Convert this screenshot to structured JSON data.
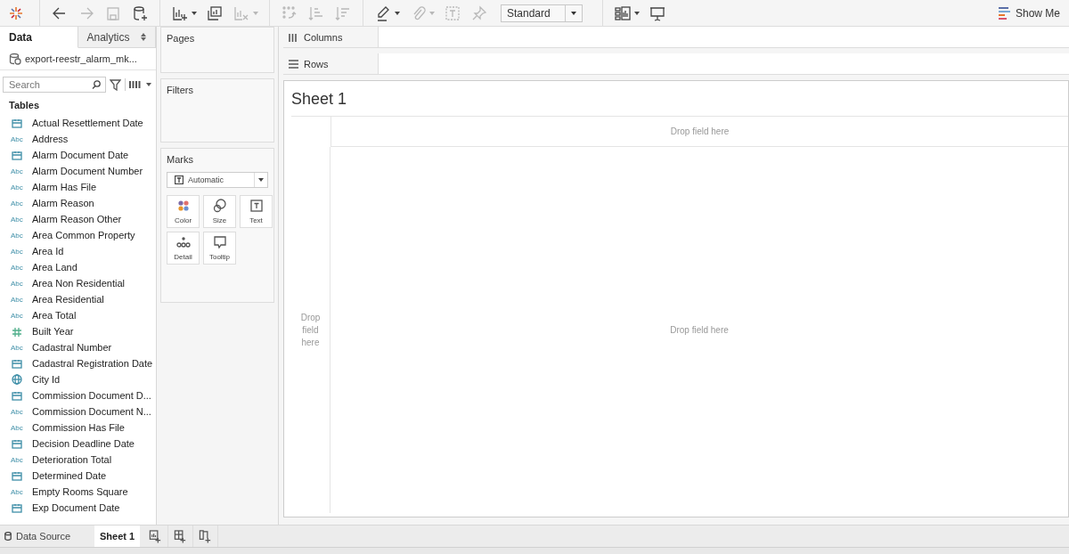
{
  "toolbar": {
    "buttons": [
      {
        "disabled": false,
        "caret": false
      },
      {
        "disabled": true,
        "caret": false
      },
      {
        "disabled": true,
        "caret": false
      },
      {
        "disabled": false,
        "caret": false
      },
      {
        "disabled": false,
        "caret": true
      },
      {
        "disabled": false,
        "caret": false
      },
      {
        "disabled": true,
        "caret": true
      },
      {
        "disabled": true,
        "caret": false
      },
      {
        "disabled": true,
        "caret": false
      },
      {
        "disabled": true,
        "caret": false
      },
      {
        "disabled": false,
        "caret": true
      },
      {
        "disabled": true,
        "caret": true
      },
      {
        "disabled": true,
        "caret": false
      },
      {
        "disabled": true,
        "caret": false
      }
    ],
    "view_select": "Standard",
    "end_buttons": [
      {
        "caret": true
      },
      {
        "caret": false
      }
    ],
    "show_me": "Show Me"
  },
  "data_pane": {
    "tabs": [
      {
        "label": "Data",
        "selected": true
      },
      {
        "label": "Analytics",
        "selected": false
      }
    ],
    "datasource": "export-reestr_alarm_mk...",
    "search": {
      "placeholder": "Search"
    },
    "tables_heading": "Tables",
    "fields": [
      {
        "name": "Actual Resettlement Date",
        "kind": "date"
      },
      {
        "name": "Address",
        "kind": "string",
        "type_label": "Abc"
      },
      {
        "name": "Alarm Document Date",
        "kind": "date"
      },
      {
        "name": "Alarm Document Number",
        "kind": "string",
        "type_label": "Abc"
      },
      {
        "name": "Alarm Has File",
        "kind": "string",
        "type_label": "Abc"
      },
      {
        "name": "Alarm Reason",
        "kind": "string",
        "type_label": "Abc"
      },
      {
        "name": "Alarm Reason Other",
        "kind": "string",
        "type_label": "Abc"
      },
      {
        "name": "Area Common Property",
        "kind": "string",
        "type_label": "Abc"
      },
      {
        "name": "Area Id",
        "kind": "string",
        "type_label": "Abc"
      },
      {
        "name": "Area Land",
        "kind": "string",
        "type_label": "Abc"
      },
      {
        "name": "Area Non Residential",
        "kind": "string",
        "type_label": "Abc"
      },
      {
        "name": "Area Residential",
        "kind": "string",
        "type_label": "Abc"
      },
      {
        "name": "Area Total",
        "kind": "string",
        "type_label": "Abc"
      },
      {
        "name": "Built Year",
        "kind": "number"
      },
      {
        "name": "Cadastral Number",
        "kind": "string",
        "type_label": "Abc"
      },
      {
        "name": "Cadastral Registration Date",
        "kind": "date"
      },
      {
        "name": "City Id",
        "kind": "geo"
      },
      {
        "name": "Commission Document D...",
        "kind": "date"
      },
      {
        "name": "Commission Document N...",
        "kind": "string",
        "type_label": "Abc"
      },
      {
        "name": "Commission Has File",
        "kind": "string",
        "type_label": "Abc"
      },
      {
        "name": "Decision Deadline Date",
        "kind": "date"
      },
      {
        "name": "Deterioration Total",
        "kind": "string",
        "type_label": "Abc"
      },
      {
        "name": "Determined Date",
        "kind": "date"
      },
      {
        "name": "Empty Rooms Square",
        "kind": "string",
        "type_label": "Abc"
      },
      {
        "name": "Exp Document Date",
        "kind": "date"
      }
    ]
  },
  "cards": {
    "pages": "Pages",
    "filters": "Filters",
    "marks": {
      "title": "Marks",
      "mark_type": "Automatic",
      "buttons": [
        {
          "label": "Color",
          "kind": "color"
        },
        {
          "label": "Size",
          "kind": "size"
        },
        {
          "label": "Text",
          "kind": "text"
        },
        {
          "label": "Detail",
          "kind": "detail"
        },
        {
          "label": "Tooltip",
          "kind": "tooltip"
        }
      ]
    }
  },
  "shelves": [
    {
      "label": "Columns",
      "kind": "columns"
    },
    {
      "label": "Rows",
      "kind": "rows"
    }
  ],
  "sheet": {
    "title": "Sheet 1",
    "columns_hint": "Drop field here",
    "rows_hint": "Drop field here",
    "center_hint": "Drop field here"
  },
  "sheet_tabs": {
    "tabs": [
      {
        "label": "Data Source",
        "kind": "datasource",
        "selected": false
      },
      {
        "label": "Sheet 1",
        "kind": "sheet",
        "selected": true
      }
    ],
    "new_buttons": [
      {
        "kind": "new-worksheet"
      },
      {
        "kind": "new-dashboard"
      },
      {
        "kind": "new-story"
      }
    ]
  }
}
